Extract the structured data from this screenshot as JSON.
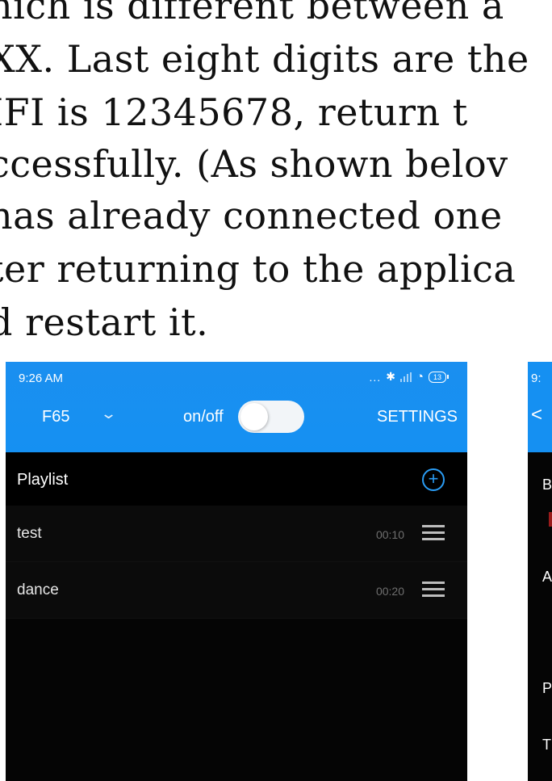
{
  "document": {
    "lines": [
      "hich is different between a",
      "XX. Last eight digits are the",
      "IFI is 12345678, return t",
      "ccessfully. (As shown belov",
      "has already connected one",
      "ter returning to the applica",
      "d restart it."
    ]
  },
  "phone": {
    "status_bar": {
      "time": "9:26 AM",
      "dots": "...",
      "bluetooth_icon": "bluetooth-icon",
      "wifi_icon": "wifi-icon",
      "battery": "13"
    },
    "header": {
      "device": "F65",
      "device_chevron": "⌄",
      "onoff_label": "on/off",
      "settings": "SETTINGS"
    },
    "playlist": {
      "title": "Playlist",
      "add_symbol": "+"
    },
    "rows": [
      {
        "name": "test",
        "time": "00:10"
      },
      {
        "name": "dance",
        "time": "00:20"
      }
    ],
    "colors": {
      "header_blue": "#1590f2",
      "accent_blue": "#2a9cf4",
      "background": "#050505"
    }
  },
  "phone2": {
    "time": "9:",
    "back": "<",
    "letters": [
      "B",
      "A",
      "P",
      "T"
    ]
  }
}
